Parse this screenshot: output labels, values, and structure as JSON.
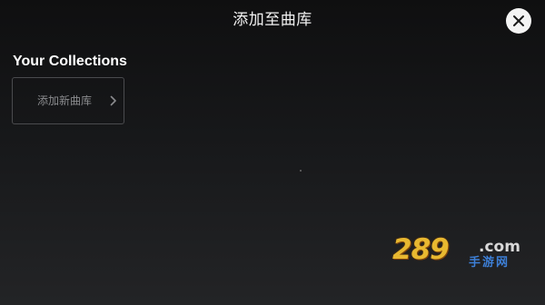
{
  "header": {
    "title": "添加至曲库",
    "close_icon": "close-icon"
  },
  "collections": {
    "heading": "Your Collections",
    "add_card": {
      "label": "添加新曲库",
      "icon": "chevron-right-icon"
    }
  },
  "watermark": {
    "number": "289",
    "domain": ".com",
    "subtitle": "手游网"
  },
  "colors": {
    "background_top": "#0f0f10",
    "background_bottom": "#232426",
    "close_button": "#f4f4f4",
    "card_border": "#4a4b4e",
    "muted_text": "#8a8b8e"
  }
}
